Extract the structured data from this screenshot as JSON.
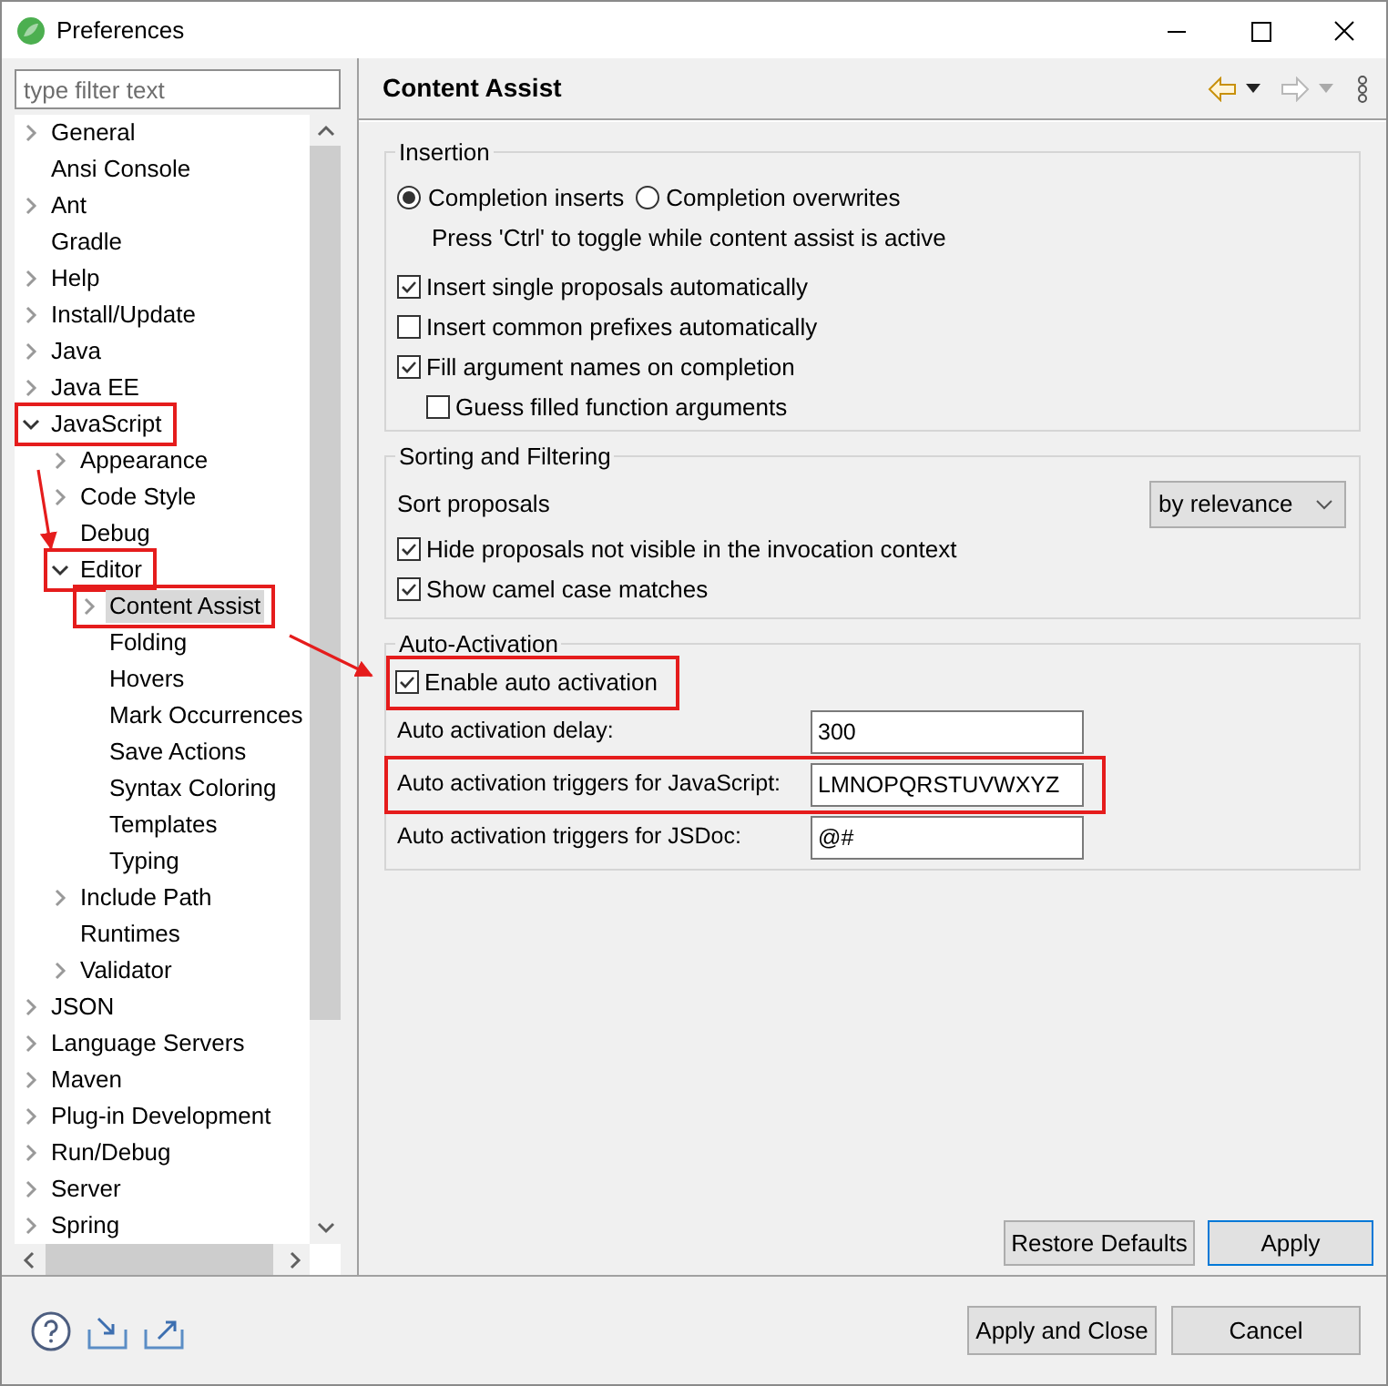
{
  "window": {
    "title": "Preferences"
  },
  "filter": {
    "placeholder": "type filter text"
  },
  "tree": [
    {
      "label": "General",
      "expanded": false
    },
    {
      "label": "Ansi Console"
    },
    {
      "label": "Ant",
      "expanded": false
    },
    {
      "label": "Gradle"
    },
    {
      "label": "Help",
      "expanded": false
    },
    {
      "label": "Install/Update",
      "expanded": false
    },
    {
      "label": "Java",
      "expanded": false
    },
    {
      "label": "Java EE",
      "expanded": false
    },
    {
      "label": "JavaScript",
      "expanded": true,
      "highlighted": true,
      "children": [
        {
          "label": "Appearance",
          "expanded": false
        },
        {
          "label": "Code Style",
          "expanded": false
        },
        {
          "label": "Debug"
        },
        {
          "label": "Editor",
          "expanded": true,
          "highlighted": true,
          "children": [
            {
              "label": "Content Assist",
              "expanded": false,
              "selected": true,
              "highlighted": true
            },
            {
              "label": "Folding"
            },
            {
              "label": "Hovers"
            },
            {
              "label": "Mark Occurrences"
            },
            {
              "label": "Save Actions"
            },
            {
              "label": "Syntax Coloring"
            },
            {
              "label": "Templates"
            },
            {
              "label": "Typing"
            }
          ]
        },
        {
          "label": "Include Path",
          "expanded": false
        },
        {
          "label": "Runtimes"
        },
        {
          "label": "Validator",
          "expanded": false
        }
      ]
    },
    {
      "label": "JSON",
      "expanded": false
    },
    {
      "label": "Language Servers",
      "expanded": false
    },
    {
      "label": "Maven",
      "expanded": false
    },
    {
      "label": "Plug-in Development",
      "expanded": false
    },
    {
      "label": "Run/Debug",
      "expanded": false
    },
    {
      "label": "Server",
      "expanded": false
    },
    {
      "label": "Spring",
      "expanded": false
    }
  ],
  "page": {
    "title": "Content Assist"
  },
  "insertion": {
    "title": "Insertion",
    "options": [
      {
        "label": "Completion inserts",
        "selected": true
      },
      {
        "label": "Completion overwrites",
        "selected": false
      }
    ],
    "hint": "Press 'Ctrl' to toggle while content assist is active",
    "checkboxes": [
      {
        "label": "Insert single proposals automatically",
        "checked": true
      },
      {
        "label": "Insert common prefixes automatically",
        "checked": false
      },
      {
        "label": "Fill argument names on completion",
        "checked": true,
        "children": [
          {
            "label": "Guess filled function arguments",
            "checked": false
          }
        ]
      }
    ]
  },
  "sorting": {
    "title": "Sorting and Filtering",
    "sort_label": "Sort proposals",
    "sort_value": "by relevance",
    "checkboxes": [
      {
        "label": "Hide proposals not visible in the invocation context",
        "checked": true
      },
      {
        "label": "Show camel case matches",
        "checked": true
      }
    ]
  },
  "auto_activation": {
    "title": "Auto-Activation",
    "checkboxes": [
      {
        "label": "Enable auto activation",
        "checked": true,
        "highlighted": true
      }
    ],
    "fields": [
      {
        "label": "Auto activation delay:",
        "value": "300",
        "highlighted": false
      },
      {
        "label": "Auto activation triggers for JavaScript:",
        "value": "LMNOPQRSTUVWXYZ",
        "highlighted": true
      },
      {
        "label": "Auto activation triggers for JSDoc:",
        "value": "@#",
        "highlighted": false
      }
    ]
  },
  "page_buttons": [
    {
      "label": "Restore Defaults",
      "default": false
    },
    {
      "label": "Apply",
      "default": true
    }
  ],
  "dialog_buttons": [
    {
      "label": "Apply and Close"
    },
    {
      "label": "Cancel"
    }
  ]
}
